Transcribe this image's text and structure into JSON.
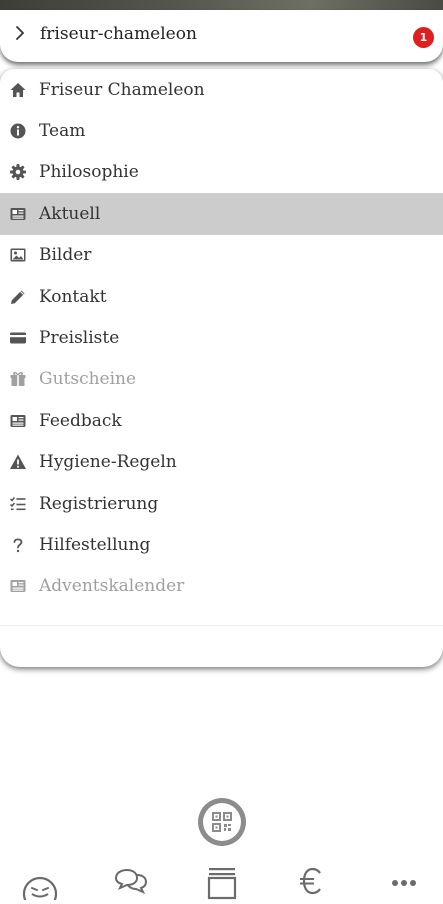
{
  "header": {
    "title": "friseur-chameleon",
    "badge_count": "1"
  },
  "menu": {
    "items": [
      {
        "label": "Friseur Chameleon",
        "icon": "home-icon",
        "active": false,
        "disabled": false
      },
      {
        "label": "Team",
        "icon": "info-icon",
        "active": false,
        "disabled": false
      },
      {
        "label": "Philosophie",
        "icon": "gear-icon",
        "active": false,
        "disabled": false
      },
      {
        "label": "Aktuell",
        "icon": "newspaper-icon",
        "active": true,
        "disabled": false
      },
      {
        "label": "Bilder",
        "icon": "image-icon",
        "active": false,
        "disabled": false
      },
      {
        "label": "Kontakt",
        "icon": "pencil-icon",
        "active": false,
        "disabled": false
      },
      {
        "label": "Preisliste",
        "icon": "credit-card-icon",
        "active": false,
        "disabled": false
      },
      {
        "label": "Gutscheine",
        "icon": "gift-icon",
        "active": false,
        "disabled": true
      },
      {
        "label": "Feedback",
        "icon": "newspaper-icon",
        "active": false,
        "disabled": false
      },
      {
        "label": "Hygiene-Regeln",
        "icon": "warning-icon",
        "active": false,
        "disabled": false
      },
      {
        "label": "Registrierung",
        "icon": "checklist-icon",
        "active": false,
        "disabled": false
      },
      {
        "label": "Hilfestellung",
        "icon": "question-icon",
        "active": false,
        "disabled": false
      },
      {
        "label": "Adventskalender",
        "icon": "newspaper-icon",
        "active": false,
        "disabled": true
      }
    ]
  },
  "qr_button": {
    "icon": "qr-code-icon"
  },
  "tabbar": {
    "tabs": [
      {
        "icon": "smiley-icon"
      },
      {
        "icon": "chat-icon"
      },
      {
        "icon": "stack-icon"
      },
      {
        "icon": "euro-icon"
      },
      {
        "icon": "more-icon"
      }
    ]
  },
  "colors": {
    "active_row": "#cccccc",
    "badge": "#e0201f",
    "icon_dark": "#555555",
    "icon_disabled": "#a0a0a0",
    "tab_icon": "#6b6b6b"
  }
}
